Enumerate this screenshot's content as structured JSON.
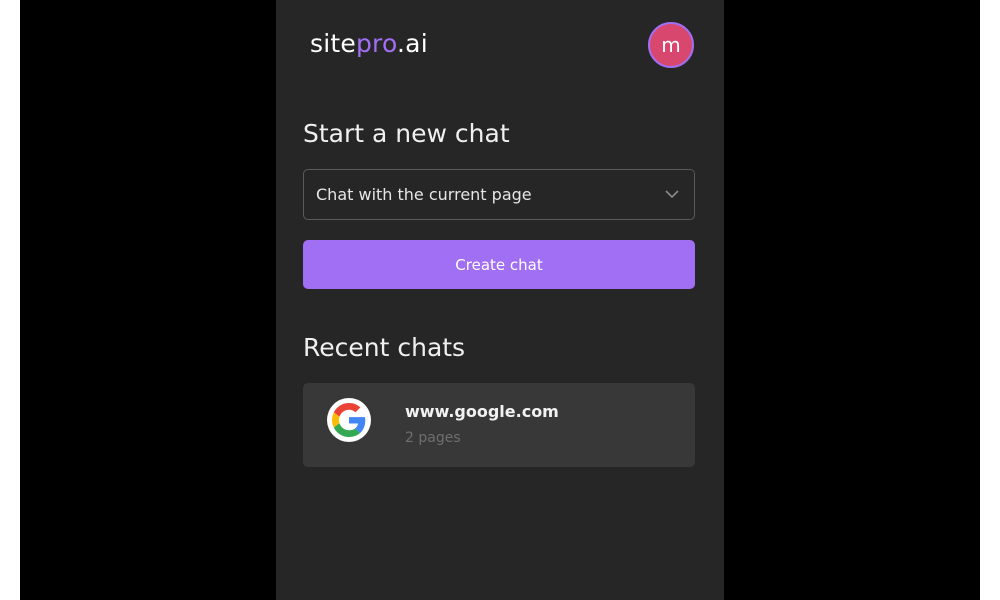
{
  "app": {
    "logo": {
      "part1": "site",
      "part2": "pro",
      "part3": ".ai"
    },
    "avatar_initial": "m"
  },
  "new_chat": {
    "title": "Start a new chat",
    "select_value": "Chat with the current page",
    "create_label": "Create chat"
  },
  "recent": {
    "title": "Recent chats",
    "items": [
      {
        "site": "www.google.com",
        "pages": "2 pages",
        "icon": "google-icon"
      }
    ]
  },
  "colors": {
    "accent": "#a16ff3",
    "panel_bg": "#262626",
    "card_bg": "#383838",
    "avatar_bg": "#d8486e",
    "letterbox": "#000000"
  }
}
